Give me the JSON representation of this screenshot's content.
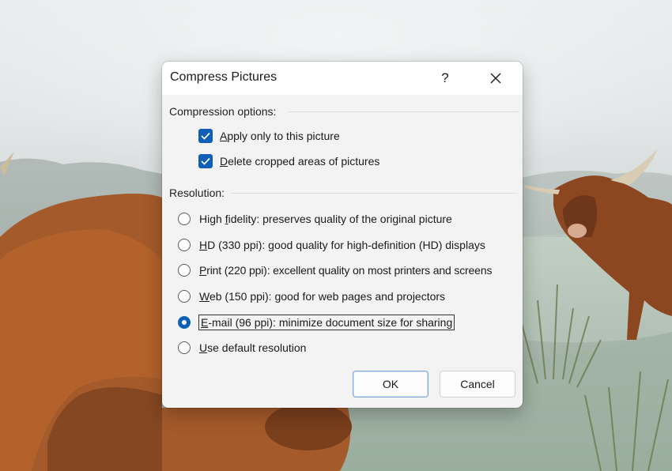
{
  "dialog": {
    "title": "Compress Pictures",
    "help_label": "?",
    "close_icon": "close-icon",
    "compression": {
      "label": "Compression options:",
      "options": [
        {
          "mnemonic": "A",
          "rest": "pply only to this picture",
          "checked": true
        },
        {
          "mnemonic": "D",
          "rest": "elete cropped areas of pictures",
          "checked": true
        }
      ]
    },
    "resolution": {
      "label": "Resolution:",
      "options": [
        {
          "pre": "High ",
          "mnemonic": "f",
          "rest": "idelity: preserves quality of the original picture",
          "checked": false
        },
        {
          "pre": "",
          "mnemonic": "H",
          "rest": "D (330 ppi): good quality for high-definition (HD) displays",
          "checked": false
        },
        {
          "pre": "",
          "mnemonic": "P",
          "rest": "rint (220 ppi): excellent quality on most printers and screens",
          "checked": false
        },
        {
          "pre": "",
          "mnemonic": "W",
          "rest": "eb (150 ppi): good for web pages and projectors",
          "checked": false
        },
        {
          "pre": "",
          "mnemonic": "E",
          "rest": "-mail (96 ppi): minimize document size for sharing",
          "checked": true
        },
        {
          "pre": "",
          "mnemonic": "U",
          "rest": "se default resolution",
          "checked": false
        }
      ]
    },
    "buttons": {
      "ok": "OK",
      "cancel": "Cancel"
    }
  },
  "colors": {
    "accent": "#0f5fb8",
    "dialog_bg": "#f3f3f3",
    "titlebar_bg": "#ffffff"
  }
}
